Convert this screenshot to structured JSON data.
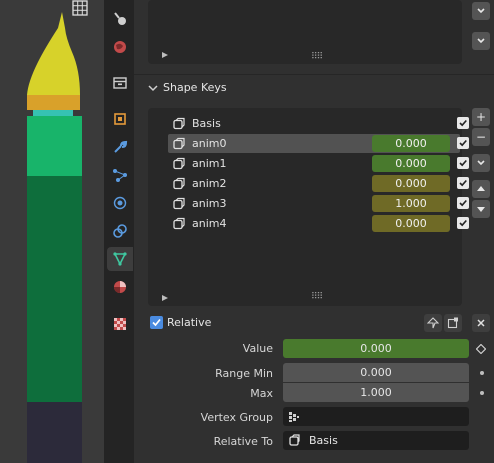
{
  "viewport": {
    "grid_icon": "grid-icon"
  },
  "tabs": [
    {
      "name": "tool-tab",
      "icon": "tool-icon",
      "active": false
    },
    {
      "name": "render-tab",
      "icon": "render-icon",
      "active": false
    },
    {
      "name": "output-tab",
      "icon": "output-icon",
      "active": false
    },
    {
      "name": "view-layer-tab",
      "icon": "view-layer-icon",
      "active": false
    },
    {
      "name": "scene-tab",
      "icon": "scene-icon",
      "active": false
    },
    {
      "name": "world-tab",
      "icon": "world-icon",
      "active": false
    },
    {
      "name": "object-tab",
      "icon": "object-icon",
      "active": false
    },
    {
      "name": "modifier-tab",
      "icon": "wrench-icon",
      "active": false
    },
    {
      "name": "particles-tab",
      "icon": "particles-icon",
      "active": false
    },
    {
      "name": "physics-tab",
      "icon": "physics-icon",
      "active": false
    },
    {
      "name": "constraints-tab",
      "icon": "constraints-icon",
      "active": false
    },
    {
      "name": "object-data-tab",
      "icon": "mesh-data-icon",
      "active": true
    },
    {
      "name": "material-tab",
      "icon": "material-icon",
      "active": false
    },
    {
      "name": "texture-tab",
      "icon": "texture-icon",
      "active": false
    }
  ],
  "shape_keys": {
    "title": "Shape Keys",
    "keys": [
      {
        "name": "Basis",
        "value": "",
        "checked": true,
        "selected": false,
        "color": ""
      },
      {
        "name": "anim0",
        "value": "0.000",
        "checked": true,
        "selected": true,
        "color": "#497a2d"
      },
      {
        "name": "anim1",
        "value": "0.000",
        "checked": true,
        "selected": false,
        "color": "#497a2d"
      },
      {
        "name": "anim2",
        "value": "0.000",
        "checked": true,
        "selected": false,
        "color": "#6f6a26"
      },
      {
        "name": "anim3",
        "value": "1.000",
        "checked": true,
        "selected": false,
        "color": "#6f6a26"
      },
      {
        "name": "anim4",
        "value": "0.000",
        "checked": true,
        "selected": false,
        "color": "#6f6a26"
      }
    ],
    "add_label": "+",
    "remove_label": "−",
    "relative_label": "Relative",
    "value_label": "Value",
    "value": "0.000",
    "range_min_label": "Range Min",
    "range_min": "0.000",
    "max_label": "Max",
    "max": "1.000",
    "vertex_group_label": "Vertex Group",
    "vertex_group_value": "",
    "relative_to_label": "Relative To",
    "relative_to_value": "Basis"
  },
  "colors": {
    "active_value": "#497a2d",
    "inactive_value": "#6f6a26",
    "panel_bg": "#303030"
  }
}
